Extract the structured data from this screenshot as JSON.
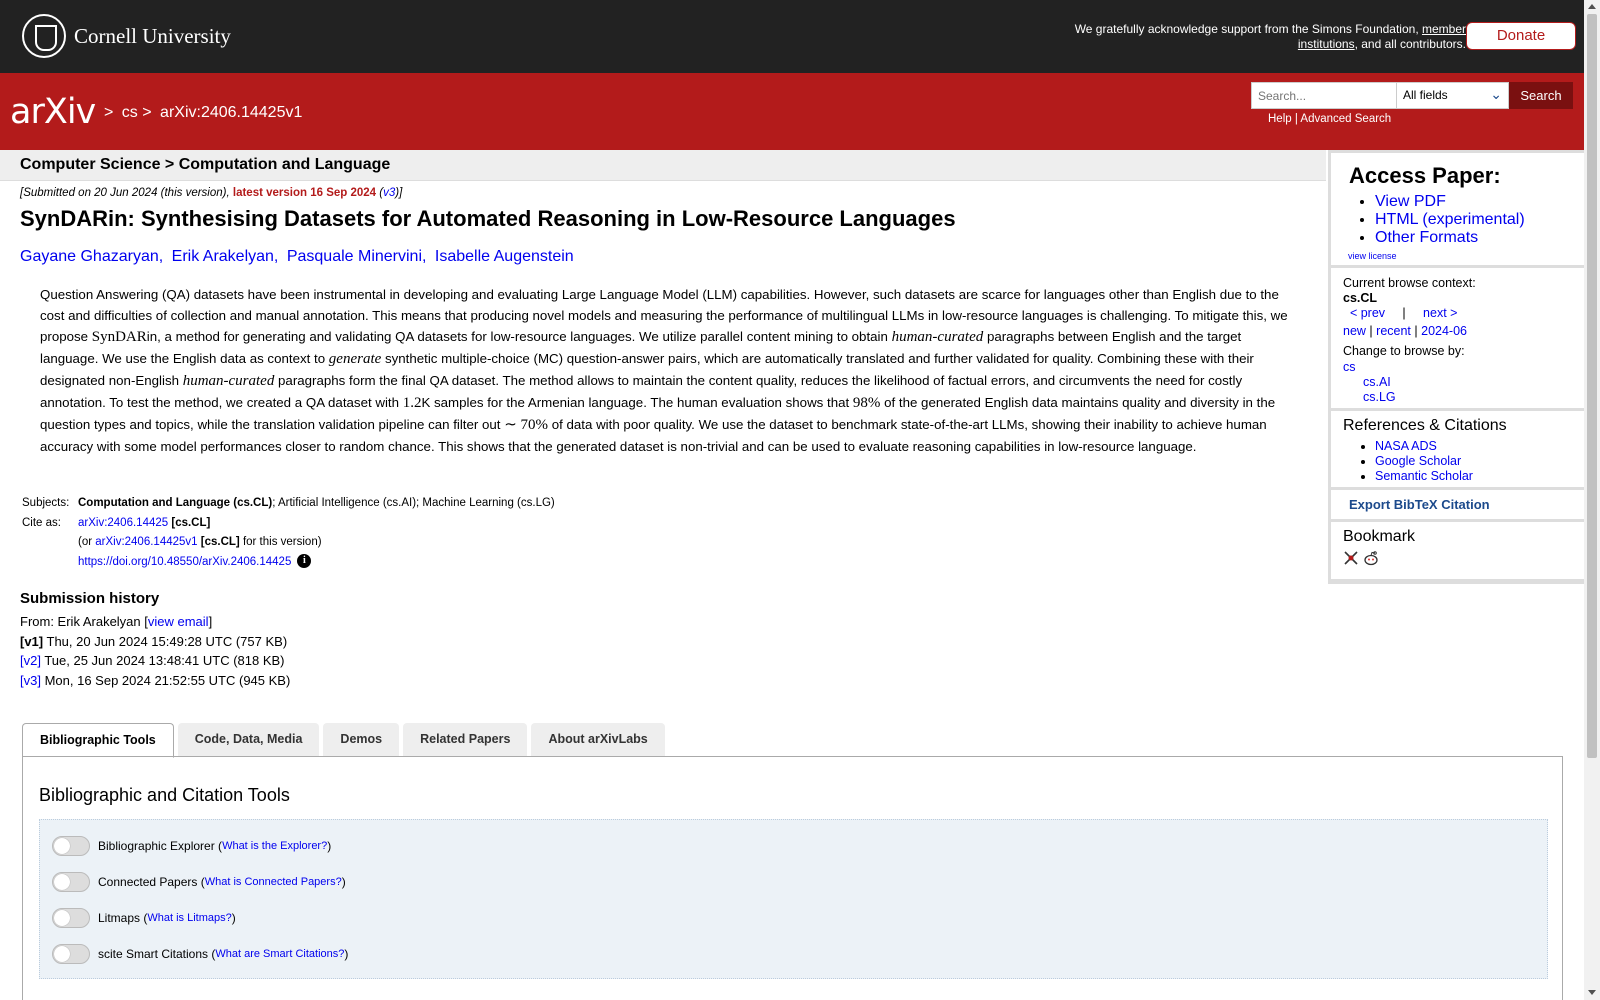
{
  "header": {
    "cornell_name": "Cornell University",
    "support_text_before": "We gratefully acknowledge support from the Simons Foundation, ",
    "support_link": "member institutions",
    "support_text_after": ", and all contributors.",
    "donate_label": "Donate"
  },
  "nav": {
    "logo": "arXiv",
    "breadcrumb": [
      ">",
      "cs",
      ">",
      "arXiv:2406.14425v1"
    ],
    "search_placeholder": "Search...",
    "search_field_selected": "All fields",
    "search_button": "Search",
    "help": "Help",
    "separator": "|",
    "advanced_search": "Advanced Search"
  },
  "paper": {
    "subject_bar": "Computer Science > Computation and Language",
    "submitted": "[Submitted on 20 Jun 2024 (this version), ",
    "latest_version": "latest version 16 Sep 2024",
    "latest_link": "v3",
    "title": "SynDARin: Synthesising Datasets for Automated Reasoning in Low-Resource Languages",
    "authors": [
      "Gayane Ghazaryan,",
      "Erik Arakelyan,",
      "Pasquale Minervini,",
      "Isabelle Augenstein"
    ],
    "abstract": {
      "p1": "Question Answering (QA) datasets have been instrumental in developing and evaluating Large Language Model (LLM) capabilities. However, such datasets are scarce for languages other than English due to the cost and difficulties of collection and manual annotation. This means that producing novel models and measuring the performance of multilingual LLMs in low-resource languages is challenging. To mitigate this, we propose ",
      "m1": "SynDAR",
      "p2": "in, a method for generating and validating QA datasets for low-resource languages. We utilize parallel content mining to obtain ",
      "m2": "human-curated",
      "p3": " paragraphs between English and the target language. We use the English data as context to ",
      "m3": "generate",
      "p4": " synthetic multiple-choice (MC) question-answer pairs, which are automatically translated and further validated for quality. Combining these with their designated non-English ",
      "m4": "human-curated",
      "p5": " paragraphs form the final QA dataset. The method allows to maintain the content quality, reduces the likelihood of factual errors, and circumvents the need for costly annotation. To test the method, we created a QA dataset with ",
      "m5": "1.2",
      "p6": "K samples for the Armenian language. The human evaluation shows that ",
      "m6": "98%",
      "p7": " of the generated English data maintains quality and diversity in the question types and topics, while the translation validation pipeline can filter out ",
      "m7": "∼ 70%",
      "p8": " of data with poor quality. We use the dataset to benchmark state-of-the-art LLMs, showing their inability to achieve human accuracy with some model performances closer to random chance. This shows that the generated dataset is non-trivial and can be used to evaluate reasoning capabilities in low-resource language."
    },
    "subjects_label": "Subjects:",
    "subjects_primary": "Computation and Language (cs.CL)",
    "subjects_rest": "; Artificial Intelligence (cs.AI); Machine Learning (cs.LG)",
    "cite_label": "Cite as:",
    "cite_id": "arXiv:2406.14425",
    "cite_cat": "[cs.CL]",
    "cite_or": "(or ",
    "cite_version_id": "arXiv:2406.14425v1",
    "cite_version_cat": "[cs.CL]",
    "cite_version_suffix": " for this version)",
    "doi": "https://doi.org/10.48550/arXiv.2406.14425",
    "info_glyph": "i"
  },
  "history": {
    "heading": "Submission history",
    "from": "From: Erik Arakelyan [",
    "view_email": "view email",
    "versions": [
      {
        "label": "[v1]",
        "text": " Thu, 20 Jun 2024 15:49:28 UTC (757 KB)"
      },
      {
        "label": "[v2]",
        "text": " Tue, 25 Jun 2024 13:48:41 UTC (818 KB)"
      },
      {
        "label": "[v3]",
        "text": " Mon, 16 Sep 2024 21:52:55 UTC (945 KB)"
      }
    ]
  },
  "sidebar": {
    "access_title": "Access Paper:",
    "access_links": [
      "View PDF",
      "HTML (experimental)",
      "Other Formats"
    ],
    "view_license": "view license",
    "browse_context_label": "Current browse context:",
    "browse_context": "cs.CL",
    "prev": "< prev",
    "pipe": "|",
    "next": "next >",
    "new": "new",
    "recent": "recent",
    "date": "2024-06",
    "change_browse": "Change to browse by:",
    "browse_cs": "cs",
    "browse_sub": [
      "cs.AI",
      "cs.LG"
    ],
    "refs_title": "References & Citations",
    "refs": [
      "NASA ADS",
      "Google Scholar",
      "Semantic Scholar"
    ],
    "export_bibtex": "Export BibTeX Citation",
    "bookmark_title": "Bookmark"
  },
  "tabs": {
    "items": [
      "Bibliographic Tools",
      "Code, Data, Media",
      "Demos",
      "Related Papers",
      "About arXivLabs"
    ],
    "panel_title": "Bibliographic and Citation Tools",
    "tools": [
      {
        "name": "Bibliographic Explorer (",
        "link": "What is the Explorer?",
        "end": ")"
      },
      {
        "name": "Connected Papers (",
        "link": "What is Connected Papers?",
        "end": ")"
      },
      {
        "name": "Litmaps (",
        "link": "What is Litmaps?",
        "end": ")"
      },
      {
        "name": "scite Smart Citations (",
        "link": "What are Smart Citations?",
        "end": ")"
      }
    ]
  },
  "colors": {
    "arxiv_red": "#b31b1b",
    "header_dark": "#222222",
    "link_blue": "#0000ee"
  }
}
